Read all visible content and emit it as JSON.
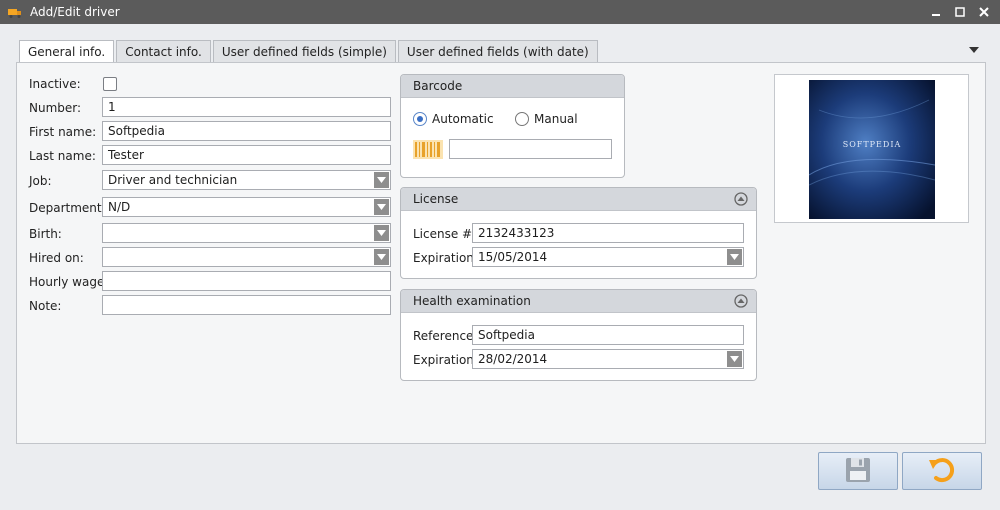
{
  "window": {
    "title": "Add/Edit driver"
  },
  "tabs": [
    {
      "label": "General info.",
      "active": true
    },
    {
      "label": "Contact info.",
      "active": false
    },
    {
      "label": "User defined fields (simple)",
      "active": false
    },
    {
      "label": "User defined fields (with date)",
      "active": false
    }
  ],
  "form": {
    "inactive_label": "Inactive:",
    "inactive_checked": false,
    "number_label": "Number:",
    "number_value": "1",
    "first_name_label": "First name:",
    "first_name_value": "Softpedia",
    "last_name_label": "Last name:",
    "last_name_value": "Tester",
    "job_label": "Job:",
    "job_value": "Driver and technician",
    "department_label": "Department:",
    "department_value": "N/D",
    "birth_label": "Birth:",
    "birth_value": "",
    "hired_label": "Hired on:",
    "hired_value": "",
    "wage_label": "Hourly wage:",
    "wage_value": "",
    "note_label": "Note:",
    "note_value": ""
  },
  "barcode": {
    "title": "Barcode",
    "automatic_label": "Automatic",
    "manual_label": "Manual",
    "selected": "Automatic",
    "value": ""
  },
  "license": {
    "title": "License",
    "number_label": "License #:",
    "number_value": "2132433123",
    "expiration_label": "Expiration:",
    "expiration_value": "15/05/2014"
  },
  "health": {
    "title": "Health examination",
    "reference_label": "Reference:",
    "reference_value": "Softpedia",
    "expiration_label": "Expiration:",
    "expiration_value": "28/02/2014"
  },
  "preview": {
    "logo_text": "SOFTPEDIA"
  },
  "colors": {
    "titlebar": "#5b5b5b",
    "accent": "#f5a623",
    "panel": "#f5f6f7"
  }
}
